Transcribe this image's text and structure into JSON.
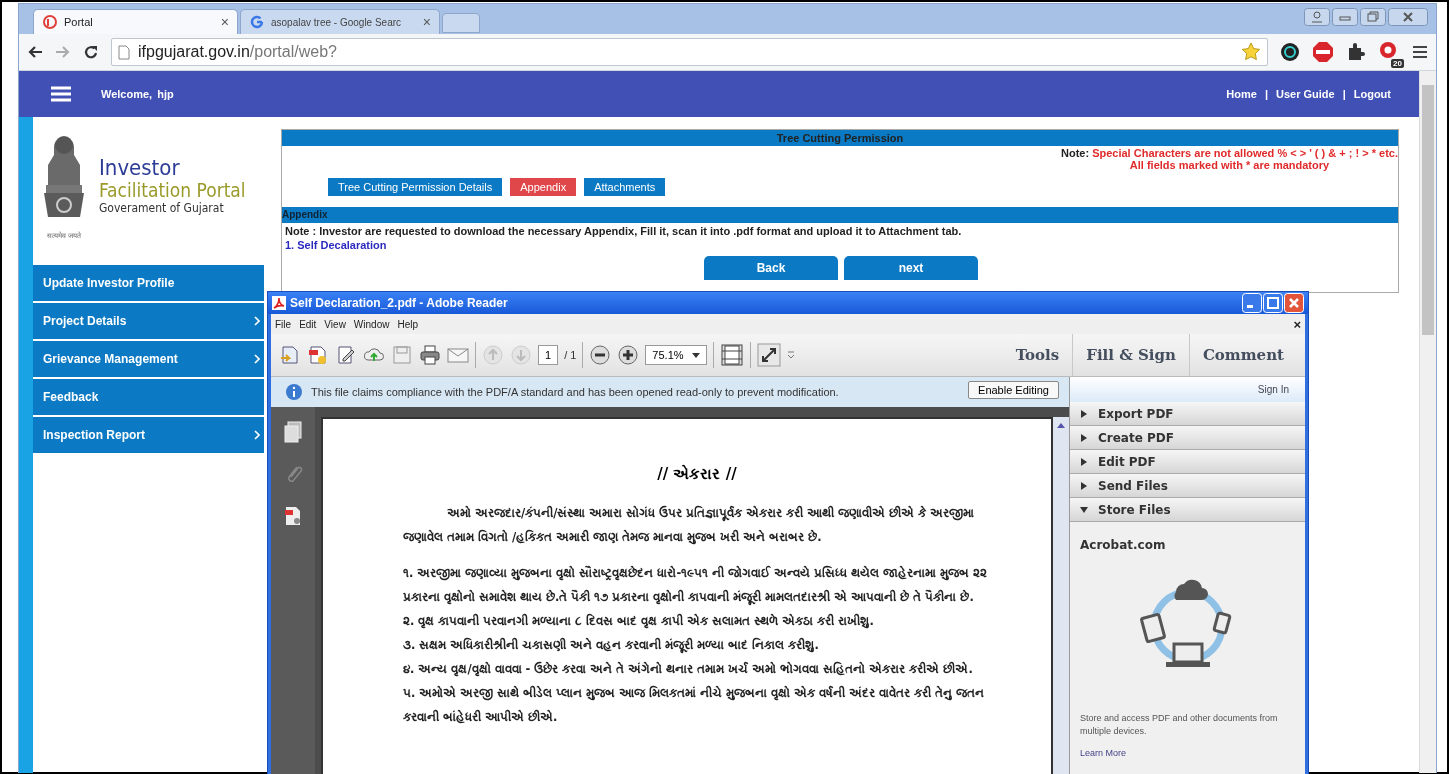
{
  "browser": {
    "tabs": [
      {
        "title": "Portal",
        "selected": true,
        "kind": "portal"
      },
      {
        "title": "asopalav tree - Google Searc",
        "selected": false,
        "kind": "google"
      }
    ],
    "close_glyph": "×",
    "url_host": "ifpgujarat.gov.in",
    "url_path": "/portal/web?",
    "extension_badge": "20"
  },
  "header": {
    "greeting": "Welcome,",
    "user": "hjp",
    "links": [
      "Home",
      "User Guide",
      "Logout"
    ],
    "separator": "|"
  },
  "logo": {
    "line1": "Investor",
    "line2": "Facilitation Portal",
    "line3": "Goverament of Gujarat",
    "motto": "सत्यमेव जयते"
  },
  "sidebar": {
    "items": [
      {
        "label": "Update Investor Profile",
        "expandable": false
      },
      {
        "label": "Project Details",
        "expandable": true
      },
      {
        "label": "Grievance Management",
        "expandable": true
      },
      {
        "label": "Feedback",
        "expandable": false
      },
      {
        "label": "Inspection Report",
        "expandable": true
      }
    ]
  },
  "form": {
    "title": "Tree Cutting Permission",
    "note_label": "Note:",
    "note_text": "Special Characters are not allowed % < > ' ( ) & + ; ! > *  etc.",
    "mandatory_text": "All fields marked with * are mandatory",
    "tabs": [
      {
        "label": "Tree Cutting Permission Details",
        "selected": false
      },
      {
        "label": "Appendix",
        "selected": true
      },
      {
        "label": "Attachments",
        "selected": false
      }
    ],
    "section": "Appendix",
    "section_note": "Note : Investor are requested to download the necessary Appendix, Fill it, scan it into .pdf format and upload it to Attachment tab.",
    "link": "1. Self Decalaration",
    "buttons": [
      "Back",
      "next"
    ]
  },
  "reader": {
    "title": "Self Declaration_2.pdf - Adobe Reader",
    "menu": [
      "File",
      "Edit",
      "View",
      "Window",
      "Help"
    ],
    "close_glyph": "×",
    "page": "1",
    "page_total": "/ 1",
    "zoom": "75.1%",
    "tool_tabs": [
      "Tools",
      "Fill & Sign",
      "Comment"
    ],
    "info": "This file claims compliance with the PDF/A standard and has been opened read-only to prevent modification.",
    "enable_button": "Enable Editing",
    "doc_title": "// એકરાર //",
    "paragraphs": [
      {
        "text": "અમો અરજદાર/કંપની/સંસ્થા અમારા સોગંધ ઉપર પ્રતિજ્ઞાપૂર્વક  એકરાર કરી આથી જણાવીએ છીએ કે અરજીમા જણાવેલ તમામ વિગતો /હકિકત અમારી જાણ તેમજ માનવા મુજબ ખરી અને બરાબર છે.",
        "kind": "intro"
      },
      {
        "text": "૧. અરજીમા જણાવ્યા મુજબના વૃક્ષો સૌરાષ્ટ્રવૃક્ષછેદન ધારો-૧૯૫૧ ની જોગવાઈ અન્વયે  પ્રસિધ્ધ થયેલ જાહેરનામા મુજબ ૨૨  પ્રકારના વૃક્ષોનો સમાવેશ થાય છે.તે પૈકી ૧૭ પ્રકારના વૃક્ષોની કાપવાની મંજૂરી મામલતદારશ્રી એ આપવાની છે તે પૈકીના છે.",
        "kind": "item"
      },
      {
        "text": "૨. વૃક્ષ કાપવાની પરવાનગી મળ્યાના ૮ દિવસ બાદ વૃક્ષ કાપી એક સલામત સ્થળે એકઠા કરી રાખીશુ.",
        "kind": "item"
      },
      {
        "text": "૩. સક્ષમ અધિકારીશ્રીની ચકાસણી અને વહન કરવાની મંજૂરી મળ્યા બાદ નિકાલ કરીશુ.",
        "kind": "item"
      },
      {
        "text": "૪. અન્ય વૃક્ષ/વૃક્ષો વાવવા - ઉછેર કરવા અને તે અંગેનો થનાર તમામ ખર્ચ અમો ભોગવવા સહિતનો એકરાર કરીએ છીએ.",
        "kind": "item"
      },
      {
        "text": "૫. અમોએ અરજી સાથે બીડેલ પ્લાન મુજબ આજ મિલકતમાં નીચે મુજબના વૃક્ષો એક વર્ષની અંદર વાવેતર કરી તેનુ જતન  કરવાની બાંહેધરી આપીએ છીએ.",
        "kind": "item"
      }
    ],
    "sign_in": "Sign In",
    "sections": [
      {
        "label": "Export PDF",
        "expanded": false
      },
      {
        "label": "Create PDF",
        "expanded": false
      },
      {
        "label": "Edit PDF",
        "expanded": false
      },
      {
        "label": "Send Files",
        "expanded": false
      },
      {
        "label": "Store Files",
        "expanded": true
      }
    ],
    "store": {
      "heading": "Acrobat.com",
      "description": "Store and access PDF and other documents from multiple devices.",
      "link": "Learn More"
    }
  }
}
